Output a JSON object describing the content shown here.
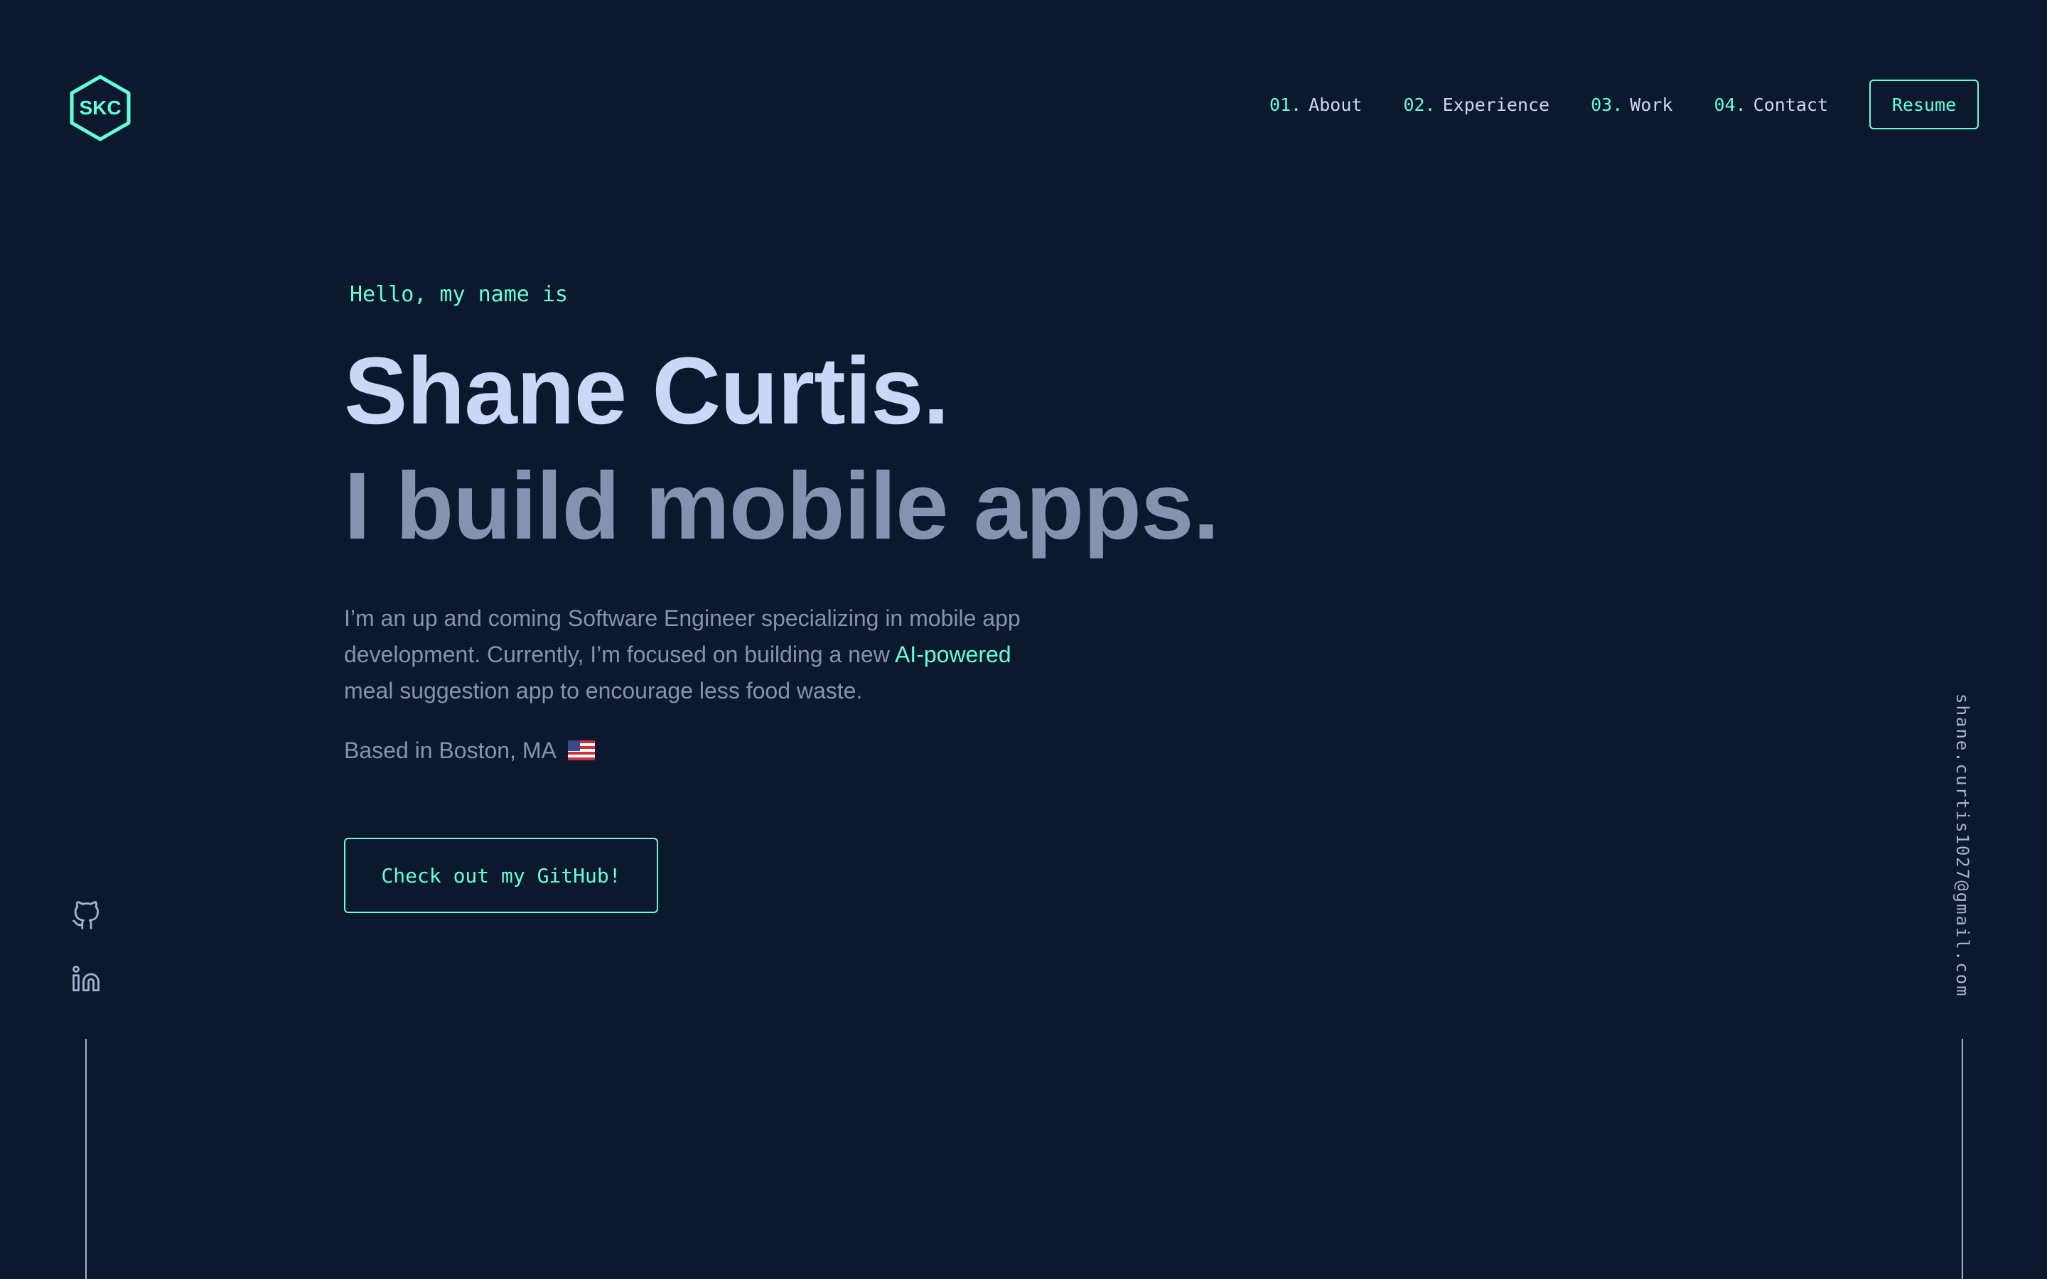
{
  "logo": {
    "text": "SKC",
    "icon": "hexagon-logo-icon"
  },
  "nav": {
    "items": [
      {
        "num": "01.",
        "label": "About"
      },
      {
        "num": "02.",
        "label": "Experience"
      },
      {
        "num": "03.",
        "label": "Work"
      },
      {
        "num": "04.",
        "label": "Contact"
      }
    ],
    "resume_label": "Resume"
  },
  "hero": {
    "greeting": "Hello, my name is",
    "name": "Shane Curtis.",
    "tagline": "I build mobile apps.",
    "bio_part1": "I’m an up and coming Software Engineer specializing in mobile app development. Currently, I’m focused on building a new ",
    "bio_highlight": "AI-powered",
    "bio_part2": " meal suggestion app to encourage less food waste.",
    "location": "Based in Boston, MA",
    "location_icon": "us-flag-icon",
    "cta_label": "Check out my GitHub!"
  },
  "socials": [
    {
      "icon": "github-icon"
    },
    {
      "icon": "linkedin-icon"
    }
  ],
  "email": "shane.curtis1027@gmail.com",
  "colors": {
    "background": "#0b182e",
    "accent": "#64ffda",
    "heading": "#ccd6f6",
    "text": "#8892b0"
  }
}
